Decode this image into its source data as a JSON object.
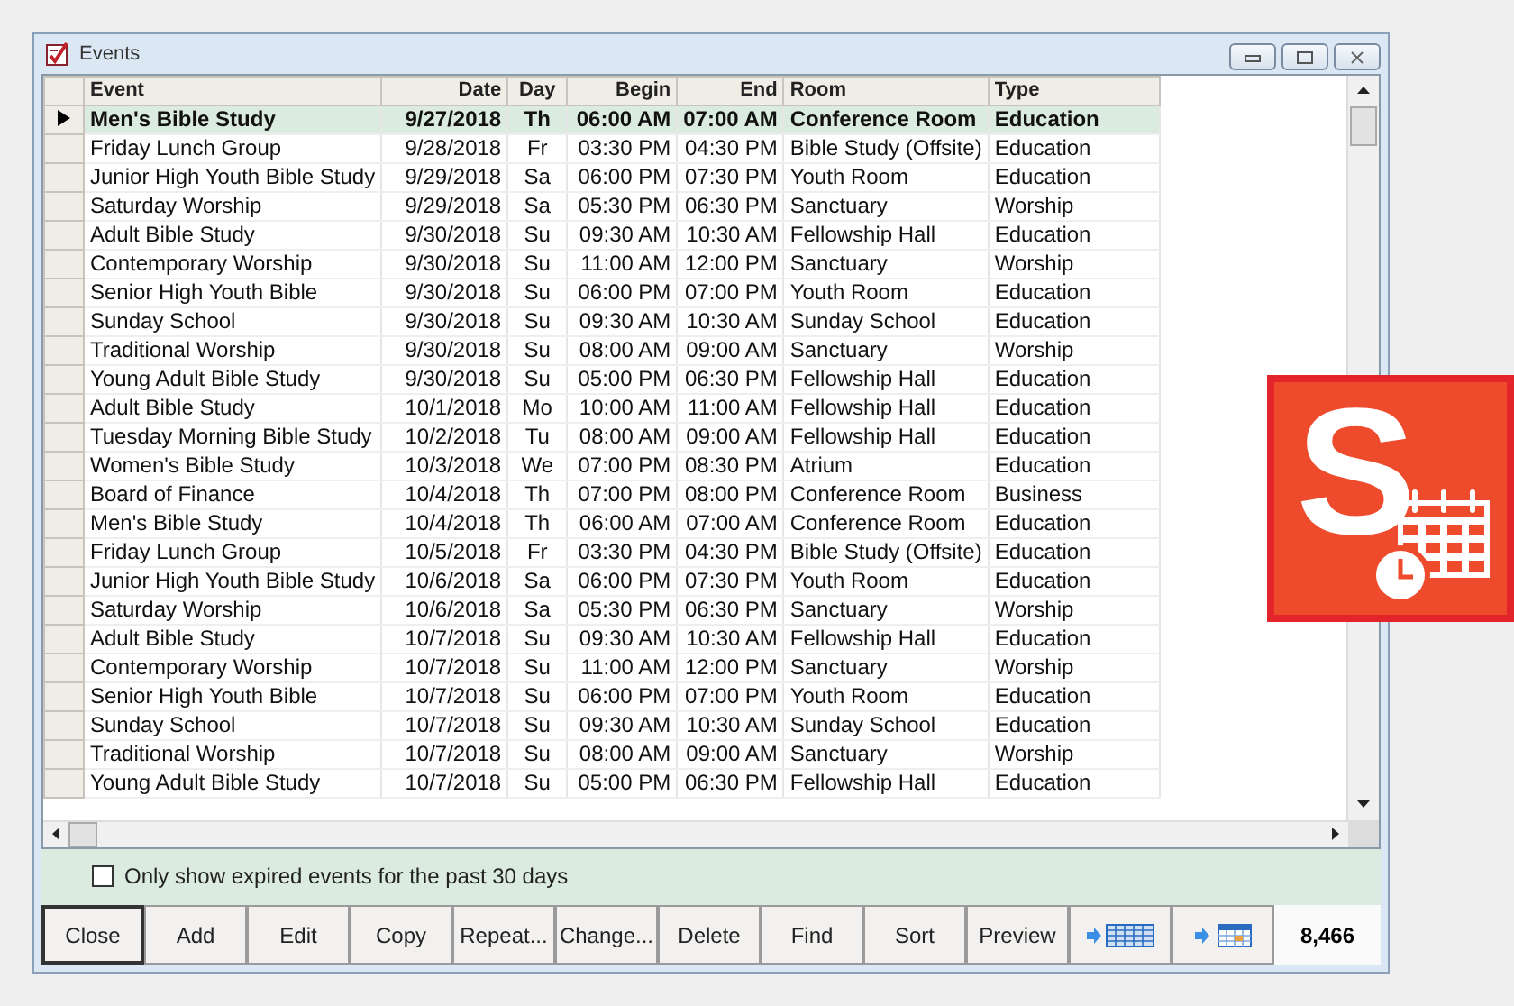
{
  "window": {
    "title": "Events"
  },
  "table": {
    "columns": [
      {
        "label": "Event"
      },
      {
        "label": "Date"
      },
      {
        "label": "Day"
      },
      {
        "label": "Begin"
      },
      {
        "label": "End"
      },
      {
        "label": "Room"
      },
      {
        "label": "Type"
      }
    ],
    "rows": [
      {
        "selected": true,
        "cells": [
          "Men's Bible Study",
          "9/27/2018",
          "Th",
          "06:00 AM",
          "07:00 AM",
          "Conference Room",
          "Education"
        ]
      },
      {
        "selected": false,
        "cells": [
          "Friday Lunch Group",
          "9/28/2018",
          "Fr",
          "03:30 PM",
          "04:30 PM",
          "Bible Study (Offsite)",
          "Education"
        ]
      },
      {
        "selected": false,
        "cells": [
          "Junior High Youth Bible Study",
          "9/29/2018",
          "Sa",
          "06:00 PM",
          "07:30 PM",
          "Youth Room",
          "Education"
        ]
      },
      {
        "selected": false,
        "cells": [
          "Saturday Worship",
          "9/29/2018",
          "Sa",
          "05:30 PM",
          "06:30 PM",
          "Sanctuary",
          "Worship"
        ]
      },
      {
        "selected": false,
        "cells": [
          "Adult Bible Study",
          "9/30/2018",
          "Su",
          "09:30 AM",
          "10:30 AM",
          "Fellowship Hall",
          "Education"
        ]
      },
      {
        "selected": false,
        "cells": [
          "Contemporary Worship",
          "9/30/2018",
          "Su",
          "11:00 AM",
          "12:00 PM",
          "Sanctuary",
          "Worship"
        ]
      },
      {
        "selected": false,
        "cells": [
          "Senior High Youth Bible",
          "9/30/2018",
          "Su",
          "06:00 PM",
          "07:00 PM",
          "Youth Room",
          "Education"
        ]
      },
      {
        "selected": false,
        "cells": [
          "Sunday School",
          "9/30/2018",
          "Su",
          "09:30 AM",
          "10:30 AM",
          "Sunday School",
          "Education"
        ]
      },
      {
        "selected": false,
        "cells": [
          "Traditional Worship",
          "9/30/2018",
          "Su",
          "08:00 AM",
          "09:00 AM",
          "Sanctuary",
          "Worship"
        ]
      },
      {
        "selected": false,
        "cells": [
          "Young Adult Bible Study",
          "9/30/2018",
          "Su",
          "05:00 PM",
          "06:30 PM",
          "Fellowship Hall",
          "Education"
        ]
      },
      {
        "selected": false,
        "cells": [
          "Adult Bible Study",
          "10/1/2018",
          "Mo",
          "10:00 AM",
          "11:00 AM",
          "Fellowship Hall",
          "Education"
        ]
      },
      {
        "selected": false,
        "cells": [
          "Tuesday Morning Bible Study",
          "10/2/2018",
          "Tu",
          "08:00 AM",
          "09:00 AM",
          "Fellowship Hall",
          "Education"
        ]
      },
      {
        "selected": false,
        "cells": [
          "Women's Bible Study",
          "10/3/2018",
          "We",
          "07:00 PM",
          "08:30 PM",
          "Atrium",
          "Education"
        ]
      },
      {
        "selected": false,
        "cells": [
          "Board of Finance",
          "10/4/2018",
          "Th",
          "07:00 PM",
          "08:00 PM",
          "Conference Room",
          "Business"
        ]
      },
      {
        "selected": false,
        "cells": [
          "Men's Bible Study",
          "10/4/2018",
          "Th",
          "06:00 AM",
          "07:00 AM",
          "Conference Room",
          "Education"
        ]
      },
      {
        "selected": false,
        "cells": [
          "Friday Lunch Group",
          "10/5/2018",
          "Fr",
          "03:30 PM",
          "04:30 PM",
          "Bible Study (Offsite)",
          "Education"
        ]
      },
      {
        "selected": false,
        "cells": [
          "Junior High Youth Bible Study",
          "10/6/2018",
          "Sa",
          "06:00 PM",
          "07:30 PM",
          "Youth Room",
          "Education"
        ]
      },
      {
        "selected": false,
        "cells": [
          "Saturday Worship",
          "10/6/2018",
          "Sa",
          "05:30 PM",
          "06:30 PM",
          "Sanctuary",
          "Worship"
        ]
      },
      {
        "selected": false,
        "cells": [
          "Adult Bible Study",
          "10/7/2018",
          "Su",
          "09:30 AM",
          "10:30 AM",
          "Fellowship Hall",
          "Education"
        ]
      },
      {
        "selected": false,
        "cells": [
          "Contemporary Worship",
          "10/7/2018",
          "Su",
          "11:00 AM",
          "12:00 PM",
          "Sanctuary",
          "Worship"
        ]
      },
      {
        "selected": false,
        "cells": [
          "Senior High Youth Bible",
          "10/7/2018",
          "Su",
          "06:00 PM",
          "07:00 PM",
          "Youth Room",
          "Education"
        ]
      },
      {
        "selected": false,
        "cells": [
          "Sunday School",
          "10/7/2018",
          "Su",
          "09:30 AM",
          "10:30 AM",
          "Sunday School",
          "Education"
        ]
      },
      {
        "selected": false,
        "cells": [
          "Traditional Worship",
          "10/7/2018",
          "Su",
          "08:00 AM",
          "09:00 AM",
          "Sanctuary",
          "Worship"
        ]
      },
      {
        "selected": false,
        "cells": [
          "Young Adult Bible Study",
          "10/7/2018",
          "Su",
          "05:00 PM",
          "06:30 PM",
          "Fellowship Hall",
          "Education"
        ]
      }
    ]
  },
  "filter": {
    "label": "Only show expired events for the past 30 days",
    "checked": false
  },
  "buttons": [
    {
      "kind": "text",
      "label": "Close",
      "default": true
    },
    {
      "kind": "text",
      "label": "Add",
      "default": false
    },
    {
      "kind": "text",
      "label": "Edit",
      "default": false
    },
    {
      "kind": "text",
      "label": "Copy",
      "default": false
    },
    {
      "kind": "text",
      "label": "Repeat...",
      "default": false
    },
    {
      "kind": "text",
      "label": "Change...",
      "default": false
    },
    {
      "kind": "text",
      "label": "Delete",
      "default": false
    },
    {
      "kind": "text",
      "label": "Find",
      "default": false
    },
    {
      "kind": "text",
      "label": "Sort",
      "default": false
    },
    {
      "kind": "text",
      "label": "Preview",
      "default": false
    },
    {
      "kind": "export-grid",
      "default": false
    },
    {
      "kind": "export-calendar",
      "default": false
    }
  ],
  "record_count": "8,466",
  "logo": {
    "letter": "S"
  }
}
